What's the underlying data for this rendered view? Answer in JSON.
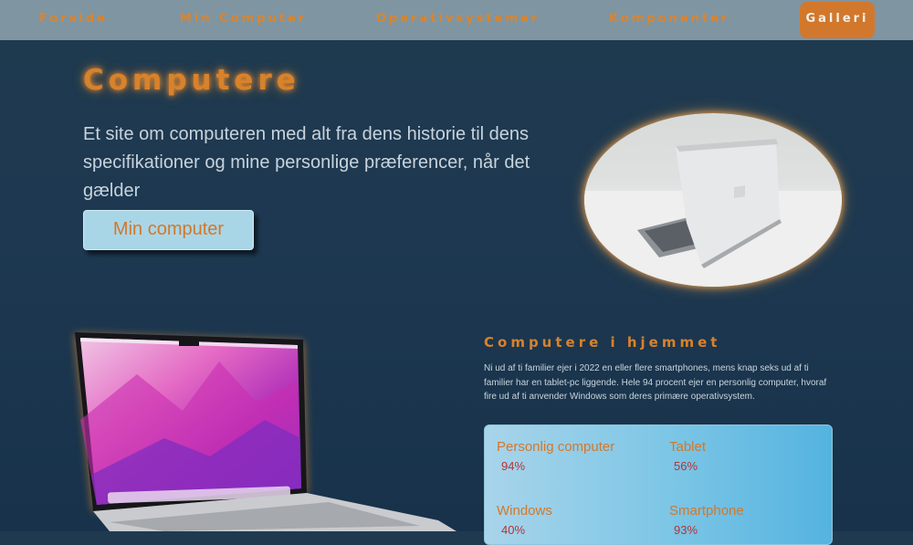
{
  "nav": {
    "items": [
      "Forside",
      "Min Computer",
      "Operativsystemer",
      "Komponenter"
    ],
    "active": "Galleri"
  },
  "hero": {
    "title": "Computere",
    "text": "Et site om computeren med alt fra dens historie til dens specifikationer og mine personlige præferencer, når det gælder",
    "button": "Min computer"
  },
  "stats": {
    "title": "Computere i hjemmet",
    "text": "Ni ud af ti familier ejer i 2022 en eller flere smartphones, mens knap seks ud af ti familier har en tablet-pc liggende. Hele 94 procent ejer en personlig computer, hvoraf fire ud af ti anvender Windows som deres primære operativsystem.",
    "items": [
      {
        "label": "Personlig computer",
        "value": "94%"
      },
      {
        "label": "Tablet",
        "value": "56%"
      },
      {
        "label": "Windows",
        "value": "40%"
      },
      {
        "label": "Smartphone",
        "value": "93%"
      }
    ]
  },
  "colors": {
    "accent": "#d8822c",
    "nav_bg": "#7f95a2",
    "page_bg": "#1e3a50",
    "button_bg": "#a9d6e6",
    "stat_value": "#b0343a"
  }
}
